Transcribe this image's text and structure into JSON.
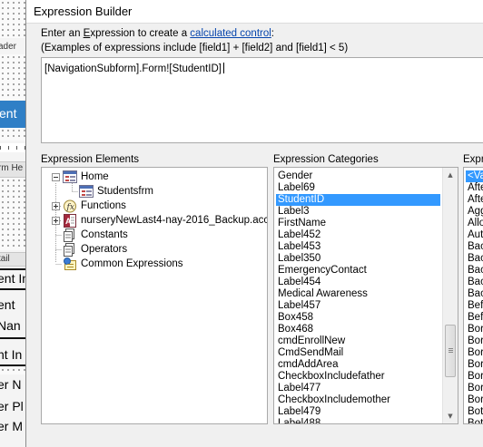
{
  "background_form": {
    "fragments": [
      "ader",
      "ent",
      "rm He",
      "tail",
      "ent In",
      "ent",
      "Nan",
      "nt In",
      "er N",
      "er Pl",
      "er M"
    ]
  },
  "dialog": {
    "title": "Expression Builder",
    "instruction_prefix": "Enter an ",
    "instruction_underlined_letter": "E",
    "instruction_after_letter": "xpression to create a ",
    "instruction_link": "calculated control",
    "instruction_suffix": ":",
    "examples_text": "(Examples of expressions include [field1] + [field2] and [field1] < 5)",
    "expression_value": "[NavigationSubform].Form![StudentID]",
    "elements_label": "Expression Elements",
    "categories_label": "Expression Categories",
    "values_label": "Expr",
    "elements_tree": [
      {
        "label": "Home",
        "icon": "form-icon",
        "expander": "minus"
      },
      {
        "label": "Studentsfrm",
        "icon": "subform-icon",
        "expander": "none"
      },
      {
        "label": "Functions",
        "icon": "function-icon",
        "expander": "plus"
      },
      {
        "label": "nurseryNewLast4-nay-2016_Backup.accdb",
        "icon": "database-icon",
        "expander": "plus"
      },
      {
        "label": "Constants",
        "icon": "constants-icon",
        "expander": "none"
      },
      {
        "label": "Operators",
        "icon": "operators-icon",
        "expander": "none"
      },
      {
        "label": "Common Expressions",
        "icon": "common-expressions-icon",
        "expander": "none"
      }
    ],
    "categories": [
      "Gender",
      "Label69",
      "StudentID",
      "Label3",
      "FirstName",
      "Label452",
      "Label453",
      "Label350",
      "EmergencyContact",
      "Label454",
      "Medical Awareness",
      "Label457",
      "Box458",
      "Box468",
      "cmdEnrollNew",
      "CmdSendMail",
      "cmdAddArea",
      "CheckboxIncludefather",
      "Label477",
      "CheckboxIncludemother",
      "Label479",
      "Label488"
    ],
    "selected_category": "StudentID",
    "values": [
      "<Va",
      "Afte",
      "Afte",
      "Agg",
      "Allo",
      "Auto",
      "Bac",
      "Bac",
      "Bac",
      "Bac",
      "Bac",
      "Befo",
      "Befo",
      "Bor",
      "Bor",
      "Bor",
      "Bor",
      "Bor",
      "Bor",
      "Bor",
      "Bot",
      "Bot"
    ],
    "selected_value": "<Va"
  },
  "colors": {
    "selection": "#3399ff",
    "background_selection": "#2f7fc6",
    "link": "#0645ad"
  }
}
